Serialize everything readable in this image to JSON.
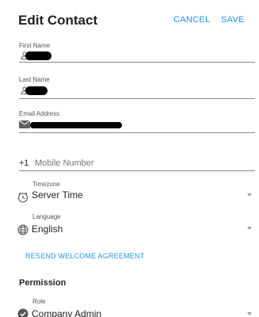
{
  "header": {
    "title": "Edit Contact",
    "cancel_label": "CANCEL",
    "save_label": "SAVE"
  },
  "first_name": {
    "label": "First Name"
  },
  "last_name": {
    "label": "Last Name"
  },
  "email": {
    "label": "Email Address"
  },
  "mobile": {
    "country_code": "+1",
    "placeholder": "Mobile Number"
  },
  "timezone": {
    "label": "Timezone",
    "value": "Server Time"
  },
  "language": {
    "label": "Language",
    "value": "English"
  },
  "resend_label": "RESEND WELCOME AGREEMENT",
  "permission": {
    "heading": "Permission",
    "role_label": "Role",
    "role_value": "Company Admin"
  },
  "colors": {
    "accent": "#2196f3",
    "text": "#212121",
    "redaction": "#000000"
  },
  "icons": [
    "person-icon",
    "mail-icon",
    "clock-icon",
    "globe-icon",
    "shield-check-icon",
    "caret-down-icon"
  ]
}
